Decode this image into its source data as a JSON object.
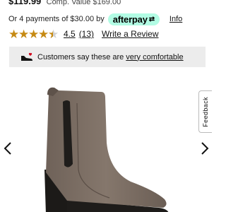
{
  "price": {
    "current": "$119.99",
    "comp_value": "Comp. Value $169.00"
  },
  "afterpay": {
    "installments_text": "Or 4 payments of $30.00 by",
    "brand": "afterpay",
    "info_link": "Info",
    "badge_color": "#b2fce4"
  },
  "rating": {
    "score": "4.5",
    "count": "(13)",
    "value": 4.5,
    "max": 5,
    "write_review": "Write a Review",
    "star_color": "#c68a12"
  },
  "banner": {
    "icon": "shoe-heart-icon",
    "text": "Customers say these are",
    "link": "very comfortable"
  },
  "gallery": {
    "prev_icon": "chevron-left-icon",
    "next_icon": "chevron-right-icon",
    "product_image": "taupe-chelsea-ankle-boot"
  },
  "feedback": {
    "label": "Feedback"
  }
}
